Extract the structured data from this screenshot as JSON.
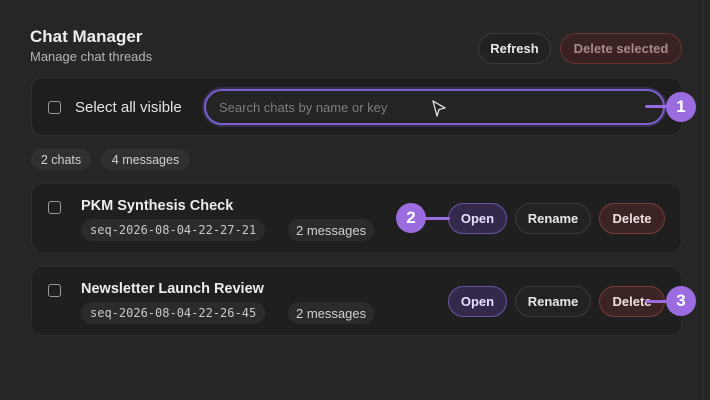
{
  "header": {
    "title": "Chat Manager",
    "subtitle": "Manage chat threads",
    "refresh_label": "Refresh",
    "delete_selected_label": "Delete selected"
  },
  "toolbar": {
    "select_all_label": "Select all visible",
    "search_placeholder": "Search chats by name or key",
    "search_value": ""
  },
  "stats": {
    "chats": "2 chats",
    "messages": "4 messages"
  },
  "chats": [
    {
      "name": "PKM Synthesis Check",
      "key": "seq-2026-08-04-22-27-21",
      "message_count": "2 messages",
      "open_label": "Open",
      "rename_label": "Rename",
      "delete_label": "Delete"
    },
    {
      "name": "Newsletter Launch Review",
      "key": "seq-2026-08-04-22-26-45",
      "message_count": "2 messages",
      "open_label": "Open",
      "rename_label": "Rename",
      "delete_label": "Delete"
    }
  ],
  "annotations": [
    "1",
    "2",
    "3"
  ],
  "colors": {
    "accent": "#9b6be0",
    "focus_border": "#7b5fd0",
    "danger": "#7a3a3a",
    "background": "#262626"
  }
}
